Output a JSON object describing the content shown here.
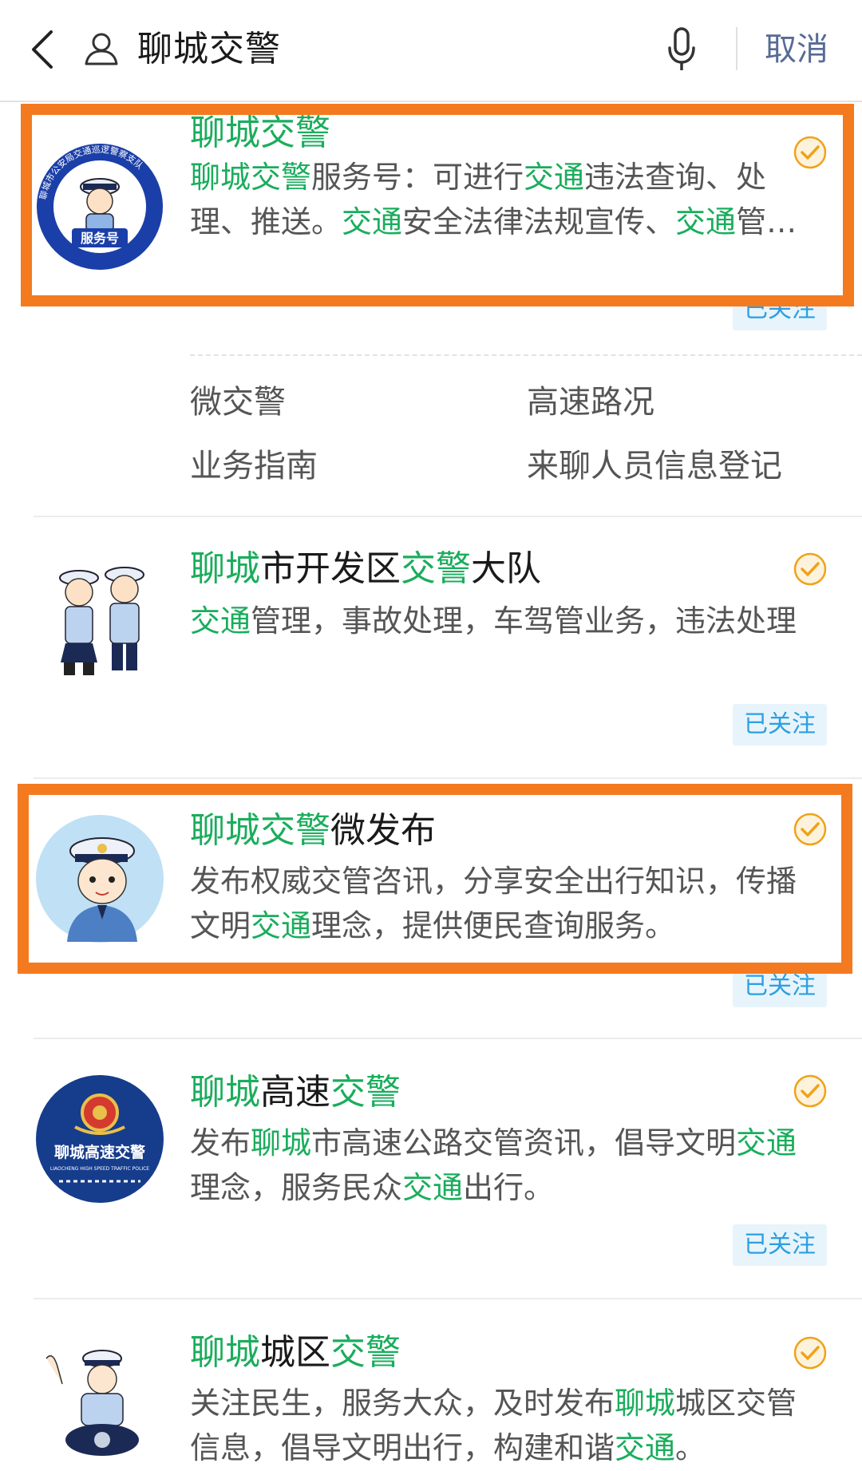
{
  "header": {
    "query": "聊城交警",
    "cancel_label": "取消",
    "icons": {
      "back": "chevron-left-icon",
      "account": "user-icon",
      "voice": "microphone-icon"
    }
  },
  "results": [
    {
      "avatar_text": "服务号",
      "avatar_ring_text": "聊城市公安局交通巡逻警察支队",
      "title_parts": [
        {
          "text": "聊城交警",
          "hl": true
        }
      ],
      "desc_parts": [
        {
          "text": "聊城交警",
          "hl": true
        },
        {
          "text": "服务号：可进行",
          "hl": false
        },
        {
          "text": "交通",
          "hl": true
        },
        {
          "text": "违法查询、处理、推送。",
          "hl": false
        },
        {
          "text": "交通",
          "hl": true
        },
        {
          "text": "安全法律法规宣传、",
          "hl": false
        },
        {
          "text": "交通",
          "hl": true
        },
        {
          "text": "管…",
          "hl": false
        }
      ],
      "followed": "已关注",
      "menu": [
        "微交警",
        "高速路况",
        "业务指南",
        "来聊人员信息登记"
      ]
    },
    {
      "title_parts": [
        {
          "text": "聊城",
          "hl": true
        },
        {
          "text": "市开发区",
          "hl": false
        },
        {
          "text": "交警",
          "hl": true
        },
        {
          "text": "大队",
          "hl": false
        }
      ],
      "desc_parts": [
        {
          "text": "交通",
          "hl": true
        },
        {
          "text": "管理，事故处理，车驾管业务，违法处理",
          "hl": false
        }
      ],
      "followed": "已关注"
    },
    {
      "title_parts": [
        {
          "text": "聊城交警",
          "hl": true
        },
        {
          "text": "微发布",
          "hl": false
        }
      ],
      "desc_parts": [
        {
          "text": "发布权威交管咨讯，分享安全出行知识，传播文明",
          "hl": false
        },
        {
          "text": "交通",
          "hl": true
        },
        {
          "text": "理念，提供便民查询服务。",
          "hl": false
        }
      ],
      "followed": "已关注"
    },
    {
      "avatar_text": "聊城高速交警",
      "avatar_subtext": "LIAOCHENG HIGH SPEED TRAFFIC POLICE",
      "title_parts": [
        {
          "text": "聊城",
          "hl": true
        },
        {
          "text": "高速",
          "hl": false
        },
        {
          "text": "交警",
          "hl": true
        }
      ],
      "desc_parts": [
        {
          "text": "发布",
          "hl": false
        },
        {
          "text": "聊城",
          "hl": true
        },
        {
          "text": "市高速公路交管资讯，倡导文明",
          "hl": false
        },
        {
          "text": "交通",
          "hl": true
        },
        {
          "text": "理念，服务民众",
          "hl": false
        },
        {
          "text": "交通",
          "hl": true
        },
        {
          "text": "出行。",
          "hl": false
        }
      ],
      "followed": "已关注"
    },
    {
      "title_parts": [
        {
          "text": "聊城",
          "hl": true
        },
        {
          "text": "城区",
          "hl": false
        },
        {
          "text": "交警",
          "hl": true
        }
      ],
      "desc_parts": [
        {
          "text": "关注民生，服务大众，及时发布",
          "hl": false
        },
        {
          "text": "聊城",
          "hl": true
        },
        {
          "text": "城区交管信息，倡导文明出行，构建和谐",
          "hl": false
        },
        {
          "text": "交通",
          "hl": true
        },
        {
          "text": "。",
          "hl": false
        }
      ]
    }
  ],
  "colors": {
    "highlight": "#1aad5c",
    "link_blue": "#576b95",
    "followed_text": "#2b9fe2",
    "annotation_box": "#f47a20",
    "verified": "#f0a21a"
  }
}
